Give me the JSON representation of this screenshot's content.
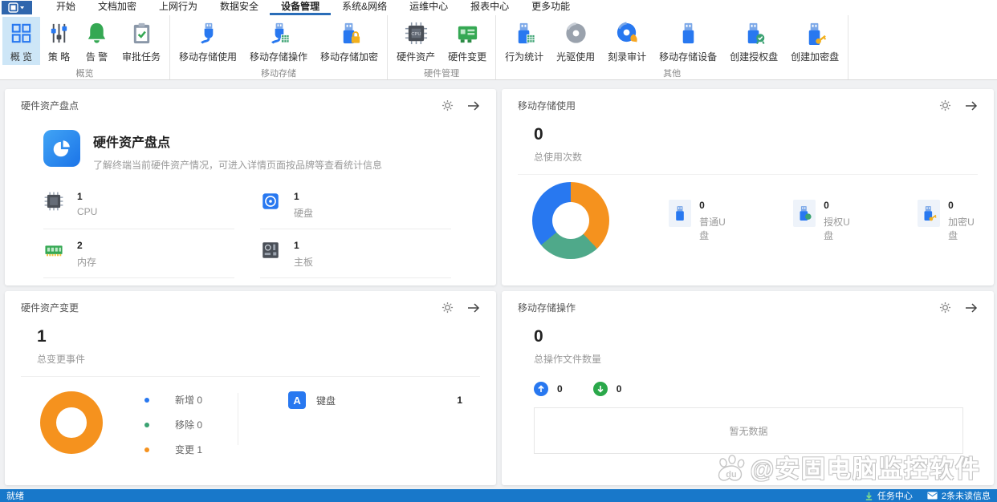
{
  "menubar": {
    "tabs": [
      "开始",
      "文档加密",
      "上网行为",
      "数据安全",
      "设备管理",
      "系统&网络",
      "运维中心",
      "报表中心",
      "更多功能"
    ],
    "active_tab": "设备管理"
  },
  "ribbon": {
    "groups": [
      {
        "label": "概览",
        "items": [
          "概 览",
          "策 略",
          "告 警",
          "审批任务"
        ]
      },
      {
        "label": "移动存储",
        "items": [
          "移动存储使用",
          "移动存储操作",
          "移动存储加密"
        ]
      },
      {
        "label": "硬件管理",
        "items": [
          "硬件资产",
          "硬件变更"
        ]
      },
      {
        "label": "其他",
        "items": [
          "行为统计",
          "光驱使用",
          "刻录审计",
          "移动存储设备",
          "创建授权盘",
          "创建加密盘"
        ]
      }
    ],
    "selected_item": "概 览"
  },
  "cards": {
    "hardware_inventory": {
      "header": "硬件资产盘点",
      "title": "硬件资产盘点",
      "description": "了解终端当前硬件资产情况，可进入详情页面按品牌等查看统计信息",
      "stats": [
        {
          "value": "1",
          "label": "CPU"
        },
        {
          "value": "1",
          "label": "硬盘"
        },
        {
          "value": "2",
          "label": "内存"
        },
        {
          "value": "1",
          "label": "主板"
        }
      ]
    },
    "storage_usage": {
      "header": "移动存储使用",
      "total_value": "0",
      "total_label": "总使用次数",
      "stats": [
        {
          "value": "0",
          "label": "普通U盘"
        },
        {
          "value": "0",
          "label": "授权U盘"
        },
        {
          "value": "0",
          "label": "加密U盘"
        }
      ]
    },
    "hardware_changes": {
      "header": "硬件资产变更",
      "total_value": "1",
      "total_label": "总变更事件",
      "legend": [
        {
          "name": "新增",
          "value": "0",
          "color": "#2878f0"
        },
        {
          "name": "移除",
          "value": "0",
          "color": "#3ba272"
        },
        {
          "name": "变更",
          "value": "1",
          "color": "#f5921e"
        }
      ],
      "device_row": {
        "icon_letter": "A",
        "label": "键盘",
        "value": "1"
      }
    },
    "storage_operations": {
      "header": "移动存储操作",
      "total_value": "0",
      "total_label": "总操作文件数量",
      "upload_count": "0",
      "download_count": "0",
      "empty_text": "暂无数据"
    }
  },
  "statusbar": {
    "ready": "就绪",
    "task_center": "任务中心",
    "unread": "2条未读信息"
  },
  "watermark": {
    "handle": "@安固电脑监控软件",
    "paw_text": "du"
  },
  "colors": {
    "accent_blue": "#2878f0",
    "tab_underline": "#2a6db8",
    "statusbar_bg": "#1878ca",
    "ribbon_selected_bg": "#cde6f7",
    "orange": "#f5921e",
    "green": "#3ba272"
  },
  "chart_data": [
    {
      "type": "pie",
      "donut": true,
      "title": "移动存储使用",
      "segments": [
        {
          "color": "#f5921e",
          "value": 38
        },
        {
          "color": "#4fa98a",
          "value": 26
        },
        {
          "color": "#2878f0",
          "value": 36
        }
      ]
    },
    {
      "type": "pie",
      "donut": true,
      "title": "硬件资产变更",
      "categories": [
        "新增",
        "移除",
        "变更"
      ],
      "values": [
        0,
        0,
        1
      ],
      "colors": [
        "#2878f0",
        "#3ba272",
        "#f5921e"
      ]
    }
  ]
}
